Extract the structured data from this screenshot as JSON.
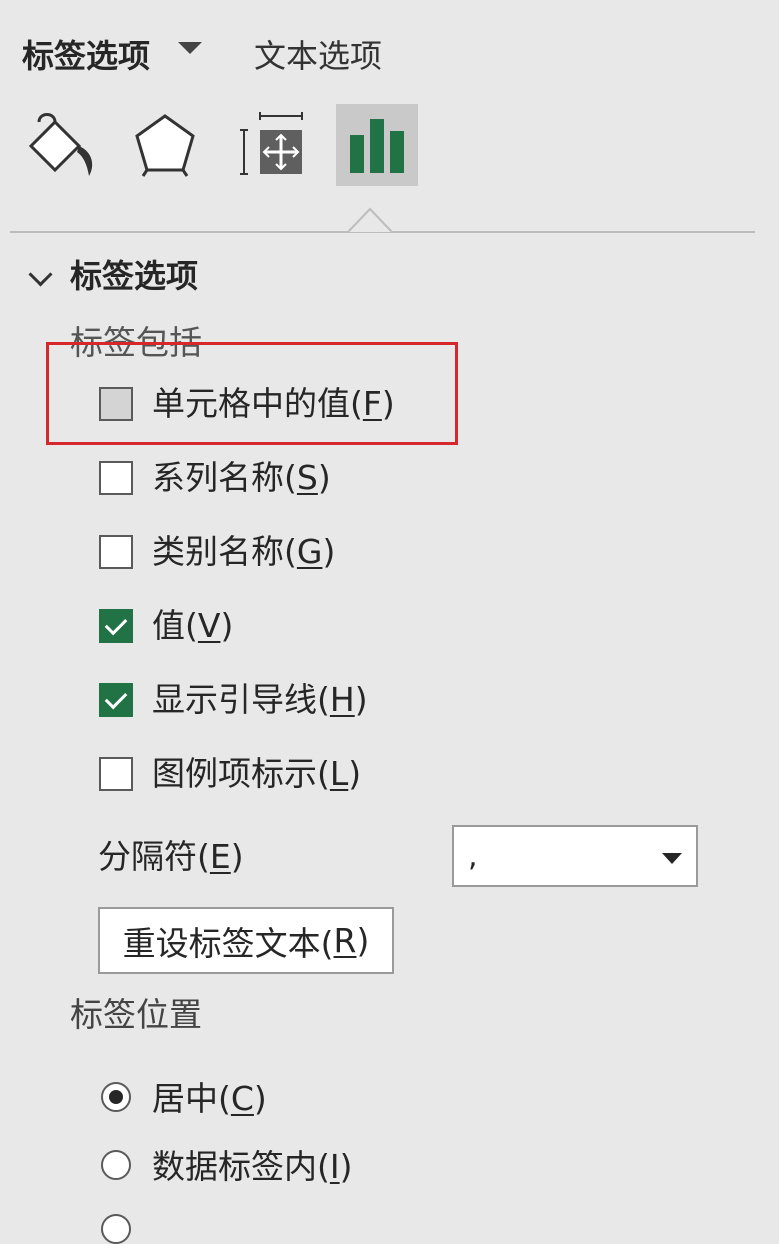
{
  "tabs": {
    "label_options": "标签选项",
    "text_options": "文本选项"
  },
  "icons": [
    "fill-bucket-icon",
    "pentagon-effects-icon",
    "size-properties-icon",
    "bar-chart-icon"
  ],
  "section": {
    "title": "标签选项",
    "label_contains": "标签包括"
  },
  "checkboxes": [
    {
      "text": "单元格中的值(",
      "key": "F",
      "tail": ")",
      "checked": false
    },
    {
      "text": "系列名称(",
      "key": "S",
      "tail": ")",
      "checked": false
    },
    {
      "text": "类别名称(",
      "key": "G",
      "tail": ")",
      "checked": false
    },
    {
      "text": "值(",
      "key": "V",
      "tail": ")",
      "checked": true
    },
    {
      "text": "显示引导线(",
      "key": "H",
      "tail": ")",
      "checked": true
    },
    {
      "text": "图例项标示(",
      "key": "L",
      "tail": ")",
      "checked": false
    }
  ],
  "separator": {
    "label": "分隔符(",
    "key": "E",
    "tail": ")",
    "value": ","
  },
  "reset_button": {
    "text": "重设标签文本(",
    "key": "R",
    "tail": ")"
  },
  "label_position": {
    "title": "标签位置",
    "options": [
      {
        "text": "居中(",
        "key": "C",
        "tail": ")",
        "selected": true
      },
      {
        "text": "数据标签内(",
        "key": "I",
        "tail": ")",
        "selected": false
      }
    ]
  },
  "colors": {
    "accent_green": "#217346",
    "highlight_red": "#d6272c"
  }
}
